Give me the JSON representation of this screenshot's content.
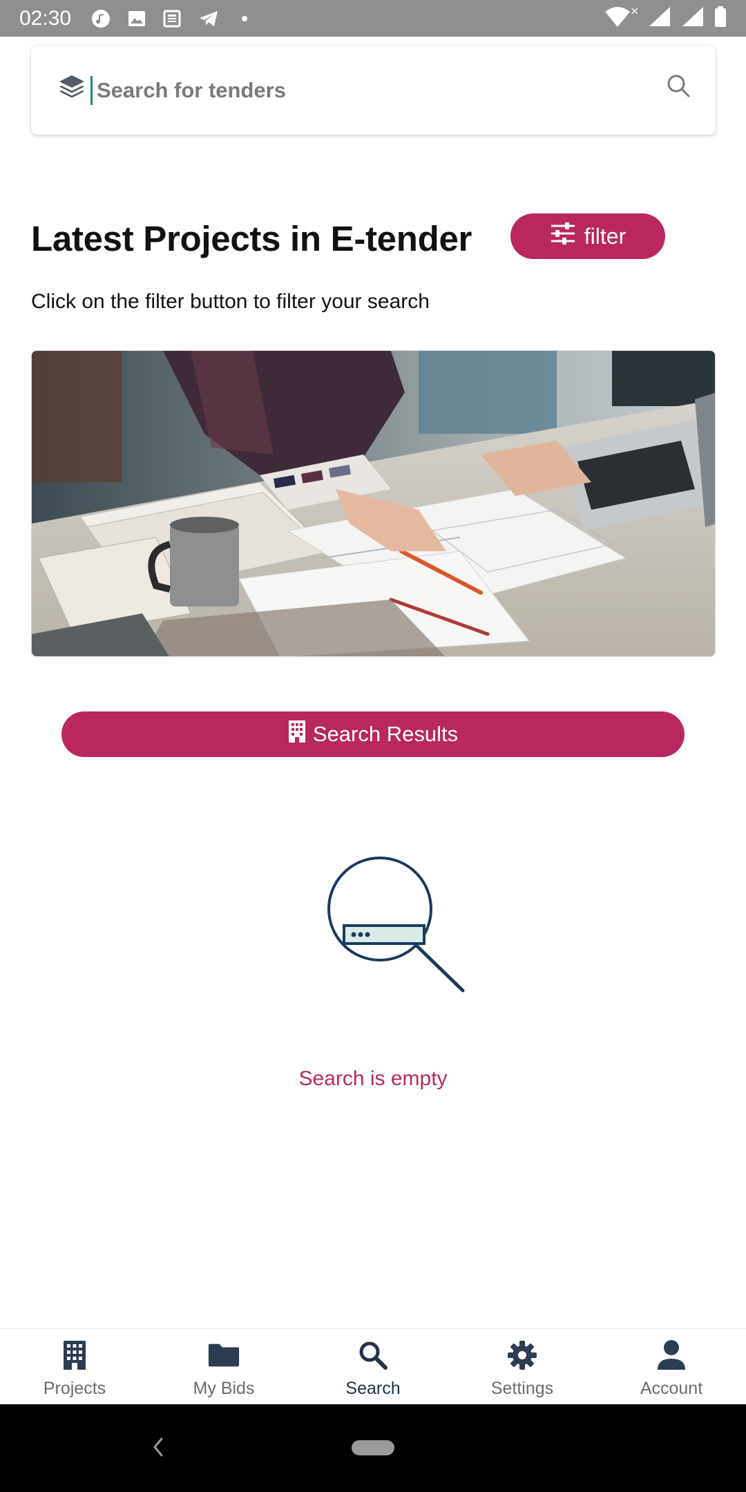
{
  "status_bar": {
    "time": "02:30",
    "left_icons": [
      "music-icon",
      "image-icon",
      "news-icon",
      "telegram-icon",
      "dot-icon"
    ],
    "right_icons": [
      "wifi-icon",
      "signal-icon",
      "signal-icon",
      "battery-icon"
    ]
  },
  "search": {
    "placeholder": "Search for tenders",
    "value": "",
    "leading_icon": "layers-icon",
    "trailing_icon": "search-icon"
  },
  "header": {
    "title": "Latest Projects in E-tender",
    "filter_label": "filter",
    "filter_icon": "sliders-icon",
    "subtitle": "Click on the filter button to filter your search"
  },
  "hero_image": {
    "description_icon": "office-desk-photo"
  },
  "results": {
    "button_label": "Search Results",
    "button_icon": "building-icon",
    "empty_text": "Search is empty",
    "empty_icon": "magnifier-empty-icon"
  },
  "bottom_nav": {
    "items": [
      {
        "label": "Projects",
        "icon": "building-icon",
        "active": false
      },
      {
        "label": "My Bids",
        "icon": "folder-icon",
        "active": false
      },
      {
        "label": "Search",
        "icon": "search-icon",
        "active": true
      },
      {
        "label": "Settings",
        "icon": "gear-icon",
        "active": false
      },
      {
        "label": "Account",
        "icon": "person-icon",
        "active": false
      }
    ]
  },
  "colors": {
    "accent": "#b8285f",
    "navy": "#22324a",
    "status_bar": "#8f8f8f"
  }
}
